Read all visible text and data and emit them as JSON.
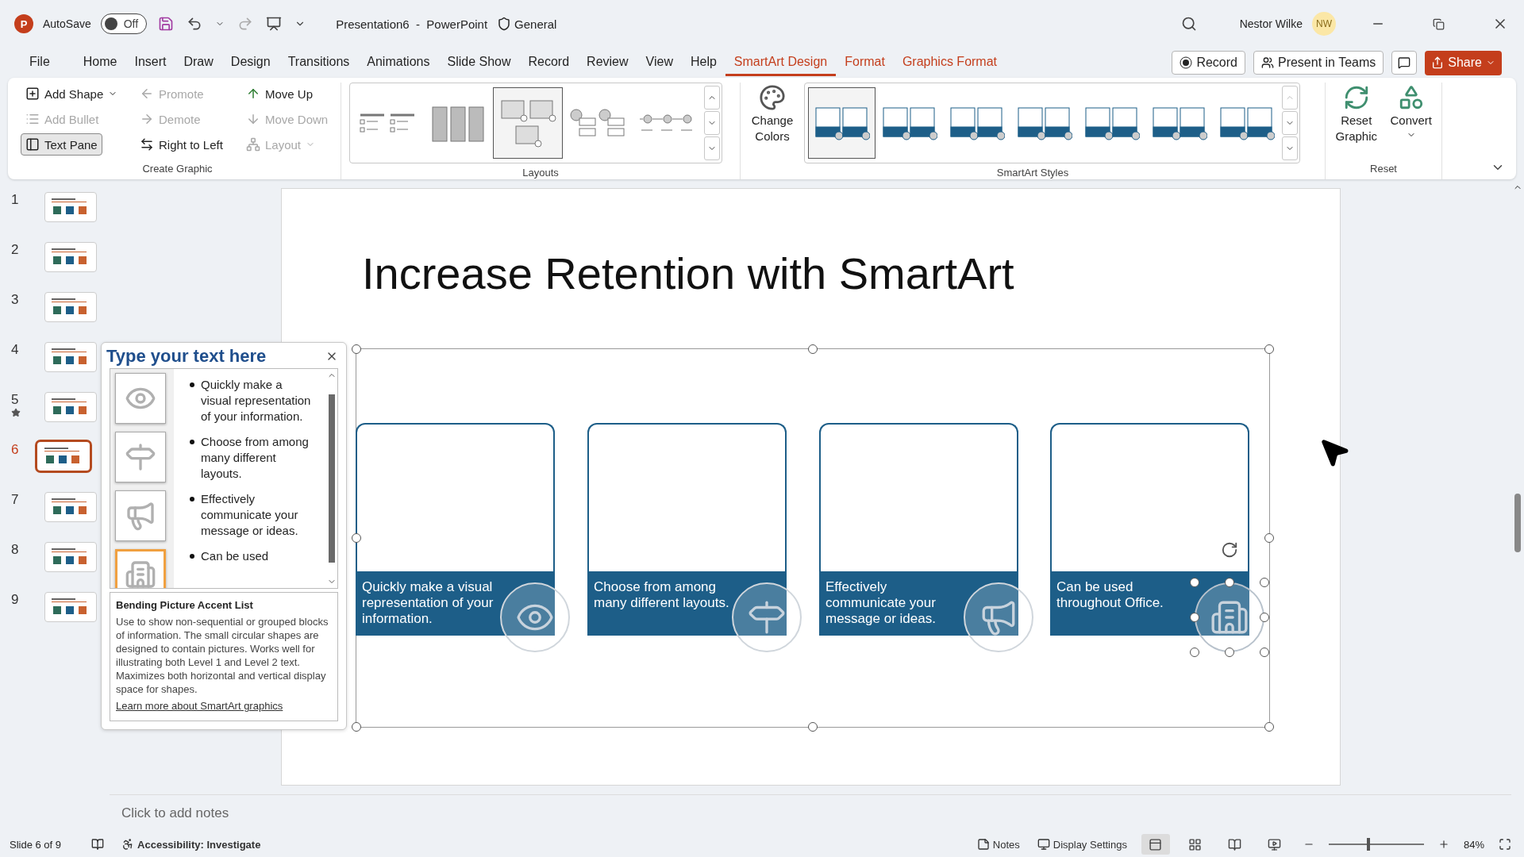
{
  "title_bar": {
    "app_logo": "P",
    "autosave_label": "AutoSave",
    "autosave": {
      "label": "Off",
      "on": false
    },
    "document_title": "Presentation6  -  PowerPoint",
    "sensitivity": "General",
    "user_name": "Nestor Wilke",
    "user_initials": "NW"
  },
  "tabs": [
    {
      "label": "File",
      "selected": false,
      "contextual": false
    },
    {
      "label": "Home",
      "selected": false,
      "contextual": false
    },
    {
      "label": "Insert",
      "selected": false,
      "contextual": false
    },
    {
      "label": "Draw",
      "selected": false,
      "contextual": false
    },
    {
      "label": "Design",
      "selected": false,
      "contextual": false
    },
    {
      "label": "Transitions",
      "selected": false,
      "contextual": false
    },
    {
      "label": "Animations",
      "selected": false,
      "contextual": false
    },
    {
      "label": "Slide Show",
      "selected": false,
      "contextual": false
    },
    {
      "label": "Record",
      "selected": false,
      "contextual": false
    },
    {
      "label": "Review",
      "selected": false,
      "contextual": false
    },
    {
      "label": "View",
      "selected": false,
      "contextual": false
    },
    {
      "label": "Help",
      "selected": false,
      "contextual": false
    },
    {
      "label": "SmartArt Design",
      "selected": true,
      "contextual": true
    },
    {
      "label": "Format",
      "selected": false,
      "contextual": true
    },
    {
      "label": "Graphics Format",
      "selected": false,
      "contextual": true
    }
  ],
  "tab_actions": {
    "record": "Record",
    "present": "Present in Teams",
    "share": "Share"
  },
  "ribbon": {
    "create_graphic": {
      "label": "Create Graphic",
      "buttons": [
        {
          "kind": "add_shape",
          "label": "Add Shape",
          "disabled": false,
          "on": false,
          "dropdown": true
        },
        {
          "kind": "add_bullet",
          "label": "Add Bullet",
          "disabled": true,
          "on": false,
          "dropdown": false
        },
        {
          "kind": "text_pane",
          "label": "Text Pane",
          "disabled": false,
          "on": true,
          "dropdown": false
        },
        {
          "kind": "promote",
          "label": "Promote",
          "disabled": true,
          "on": false,
          "dropdown": false
        },
        {
          "kind": "demote",
          "label": "Demote",
          "disabled": true,
          "on": false,
          "dropdown": false
        },
        {
          "kind": "right_to_left",
          "label": "Right to Left",
          "disabled": false,
          "on": false,
          "dropdown": false
        },
        {
          "kind": "move_up",
          "label": "Move Up",
          "disabled": false,
          "on": false,
          "dropdown": false
        },
        {
          "kind": "move_down",
          "label": "Move Down",
          "disabled": true,
          "on": false,
          "dropdown": false
        },
        {
          "kind": "layout",
          "label": "Layout",
          "disabled": true,
          "on": false,
          "dropdown": true
        }
      ]
    },
    "layouts": {
      "label": "Layouts",
      "items": [
        {
          "kind": "list",
          "selected": false
        },
        {
          "kind": "columns",
          "selected": false
        },
        {
          "kind": "bending",
          "selected": true
        },
        {
          "kind": "circles",
          "selected": false
        },
        {
          "kind": "dots",
          "selected": false
        }
      ]
    },
    "smartart_styles": {
      "label": "SmartArt Styles",
      "change_colors": "Change Colors",
      "items": [
        {
          "selected": true
        },
        {
          "selected": false
        },
        {
          "selected": false
        },
        {
          "selected": false
        },
        {
          "selected": false
        },
        {
          "selected": false
        },
        {
          "selected": false
        }
      ]
    },
    "reset": {
      "label": "Reset",
      "reset_graphic": "Reset Graphic",
      "convert": "Convert"
    }
  },
  "slides": [
    {
      "number": "1",
      "selected": false,
      "starred": false
    },
    {
      "number": "2",
      "selected": false,
      "starred": false
    },
    {
      "number": "3",
      "selected": false,
      "starred": false
    },
    {
      "number": "4",
      "selected": false,
      "starred": false
    },
    {
      "number": "5",
      "selected": false,
      "starred": true
    },
    {
      "number": "6",
      "selected": true,
      "starred": false
    },
    {
      "number": "7",
      "selected": false,
      "starred": false
    },
    {
      "number": "8",
      "selected": false,
      "starred": false
    },
    {
      "number": "9",
      "selected": false,
      "starred": false
    }
  ],
  "slide": {
    "title": "Increase Retention with SmartArt",
    "items": [
      {
        "text": "Quickly make a visual representation of your information.",
        "kind": "eye",
        "selected": false
      },
      {
        "text": "Choose from among many different layouts.",
        "kind": "signpost",
        "selected": false
      },
      {
        "text": "Effectively communicate your message or ideas.",
        "kind": "megaphone",
        "selected": false
      },
      {
        "text": "Can be used throughout Office.",
        "kind": "building",
        "selected": true
      }
    ]
  },
  "text_pane": {
    "title": "Type your text here",
    "pictures": [
      {
        "kind": "eye",
        "selected": false
      },
      {
        "kind": "signpost",
        "selected": false
      },
      {
        "kind": "megaphone",
        "selected": false
      },
      {
        "kind": "building",
        "selected": true
      }
    ],
    "bullets": [
      "Quickly make a visual representation of your information.",
      "Choose from among many different layouts.",
      "Effectively communicate your message or ideas.",
      "Can be used"
    ],
    "layout_name": "Bending Picture Accent List",
    "description": "Use to show non-sequential or grouped blocks of information. The small circular shapes are designed to contain pictures. Works well for illustrating both Level 1 and Level 2 text. Maximizes both horizontal and vertical display space for shapes.",
    "link": "Learn more about SmartArt graphics"
  },
  "notes": {
    "placeholder": "Click to add notes"
  },
  "status_bar": {
    "slide_info": "Slide 6 of 9",
    "accessibility": "Accessibility: Investigate",
    "notes": "Notes",
    "display_settings": "Display Settings",
    "views": [
      {
        "kind": "normal",
        "selected": true
      },
      {
        "kind": "sorter",
        "selected": false
      },
      {
        "kind": "reading",
        "selected": false
      },
      {
        "kind": "slideshow",
        "selected": false
      }
    ],
    "zoom": {
      "level": 0.42,
      "label": "84%"
    }
  }
}
